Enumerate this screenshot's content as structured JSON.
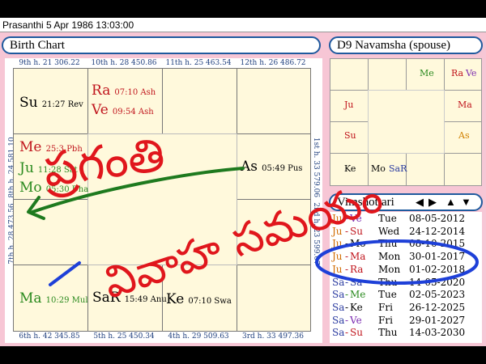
{
  "window": {
    "title": "Prasanthi   5 Apr 1986 13:03:00"
  },
  "birth_chart": {
    "title": "Birth Chart",
    "top_houses": [
      "9th h.  21  306.22",
      "10th h.  28  450.86",
      "11th h.  25  463.54",
      "12th h.  26  486.72"
    ],
    "bottom_houses": [
      "6th h.  42  345.85",
      "5th h.  25  450.34",
      "4th h.  29  509.63",
      "3rd h.  33  497.36"
    ],
    "left_houses": [
      "8th h.  24  581.10",
      "7th h.  28  473.56"
    ],
    "right_houses": [
      "1st h.  33  579.06",
      "2nd h.  23  599.07"
    ],
    "planets": {
      "su": {
        "name": "Su",
        "detail": "21:27  Rev",
        "color": "#000000"
      },
      "ra": {
        "name": "Ra",
        "detail": "07:10  Ash",
        "color": "#c0141c"
      },
      "ve": {
        "name": "Ve",
        "detail": "09:54  Ash",
        "color": "#c0141c"
      },
      "me": {
        "name": "Me",
        "detail": "25:3  Pbh",
        "color": "#c0141c"
      },
      "ju": {
        "name": "Ju",
        "detail": "11:28  Sat",
        "color": "#2a8a1e"
      },
      "mo": {
        "name": "Mo",
        "detail": "05:30  Dha",
        "color": "#2a8a1e"
      },
      "as": {
        "name": "As",
        "detail": "05:49  Pus",
        "color": "#000000"
      },
      "ma": {
        "name": "Ma",
        "detail": "10:29  Mul",
        "color": "#2a8a1e"
      },
      "sar": {
        "name": "SaR",
        "detail": "15:49  Anu",
        "color": "#000000"
      },
      "ke": {
        "name": "Ke",
        "detail": "07:10  Swa",
        "color": "#000000"
      }
    }
  },
  "navamsha": {
    "title": "D9 Navamsha  (spouse)",
    "cells": {
      "me": {
        "text": "Me",
        "color": "#2a8a1e"
      },
      "rave_ra": {
        "text": "Ra",
        "color": "#c0141c"
      },
      "rave_ve": {
        "text": "Ve",
        "color": "#7b2ab0"
      },
      "ma": {
        "text": "Ma",
        "color": "#c0141c"
      },
      "ju": {
        "text": "Ju",
        "color": "#c0141c"
      },
      "su": {
        "text": "Su",
        "color": "#c0141c"
      },
      "as": {
        "text": "As",
        "color": "#d08000"
      },
      "ke": {
        "text": "Ke",
        "color": "#000000"
      },
      "mo": {
        "text": "Mo",
        "color": "#000000"
      },
      "sar": {
        "text": "SaR",
        "color": "#2a3ba0"
      }
    }
  },
  "vimshottari": {
    "title": "Vimshottari",
    "nav": {
      "prev": "◀",
      "next": "▶",
      "up": "▲",
      "down": "▼"
    },
    "rows": [
      {
        "a": "Ju",
        "b": "Ve",
        "ca": "#d06b00",
        "cb": "#7b2ab0",
        "day": "Tue",
        "date": "08-05-2012"
      },
      {
        "a": "Ju",
        "b": "Su",
        "ca": "#d06b00",
        "cb": "#c0141c",
        "day": "Wed",
        "date": "24-12-2014"
      },
      {
        "a": "Ju",
        "b": "Mo",
        "ca": "#d06b00",
        "cb": "#000000",
        "day": "Thu",
        "date": "08-10-2015"
      },
      {
        "a": "Ju",
        "b": "Ma",
        "ca": "#d06b00",
        "cb": "#c0141c",
        "day": "Mon",
        "date": "30-01-2017"
      },
      {
        "a": "Ju",
        "b": "Ra",
        "ca": "#d06b00",
        "cb": "#c0141c",
        "day": "Mon",
        "date": "01-02-2018"
      },
      {
        "a": "Sa",
        "b": "Sa",
        "ca": "#2a3ba0",
        "cb": "#2a3ba0",
        "day": "Thu",
        "date": "14-05-2020"
      },
      {
        "a": "Sa",
        "b": "Me",
        "ca": "#2a3ba0",
        "cb": "#2a8a1e",
        "day": "Tue",
        "date": "02-05-2023"
      },
      {
        "a": "Sa",
        "b": "Ke",
        "ca": "#2a3ba0",
        "cb": "#000000",
        "day": "Fri",
        "date": "26-12-2025"
      },
      {
        "a": "Sa",
        "b": "Ve",
        "ca": "#2a3ba0",
        "cb": "#7b2ab0",
        "day": "Fri",
        "date": "29-01-2027"
      },
      {
        "a": "Sa",
        "b": "Su",
        "ca": "#2a3ba0",
        "cb": "#c0141c",
        "day": "Thu",
        "date": "14-03-2030"
      }
    ]
  },
  "annotation": {
    "line1": "ప్రగంతి",
    "line2": "వివాహ సమయం",
    "color_red": "#e0161c",
    "color_blue": "#1e40d8",
    "color_green": "#1e7a1e"
  }
}
